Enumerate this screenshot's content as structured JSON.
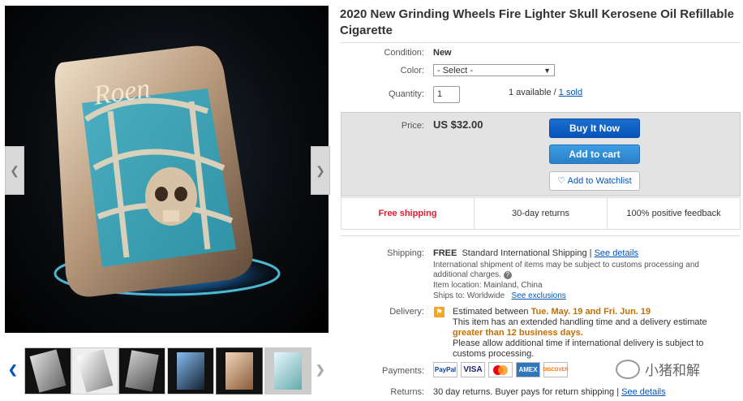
{
  "title": "2020 New Grinding Wheels Fire Lighter Skull Kerosene Oil Refillable Cigarette",
  "condition": {
    "label": "Condition:",
    "value": "New"
  },
  "color": {
    "label": "Color:",
    "selected": "- Select -"
  },
  "quantity": {
    "label": "Quantity:",
    "value": "1",
    "available": "1 available / ",
    "sold": "1 sold"
  },
  "price": {
    "label": "Price:",
    "value": "US $32.00"
  },
  "buttons": {
    "buy": "Buy It Now",
    "cart": "Add to cart",
    "watch": "Add to Watchlist"
  },
  "features": {
    "shipping": "Free shipping",
    "returns": "30-day returns",
    "feedback": "100% positive feedback"
  },
  "shipping": {
    "label": "Shipping:",
    "free": "FREE",
    "service": "Standard International Shipping |",
    "details": "See details",
    "note": "International shipment of items may be subject to customs processing and additional charges.",
    "location": "Item location:  Mainland, China",
    "ships_to": "Ships to: Worldwide",
    "exclusions": "See exclusions"
  },
  "delivery": {
    "label": "Delivery:",
    "estimated": "Estimated between ",
    "dates": "Tue. May. 19 and Fri. Jun. 19",
    "line2": "This item has an extended handling time and a delivery estimate ",
    "greater": "greater than 12 business days.",
    "line3": "Please allow additional time if international delivery is subject to customs processing."
  },
  "payments": {
    "label": "Payments:",
    "logos": [
      "PayPal",
      "VISA",
      "MC",
      "AMEX",
      "DISCOVER"
    ]
  },
  "returns": {
    "label": "Returns:",
    "text": "30 day returns. Buyer pays for return shipping |",
    "details": "See details"
  },
  "lighter_text": "Roen",
  "watermark": "小猪和解",
  "colors": {
    "accent": "#0654ba",
    "shipping_red": "#dd1e31",
    "date_orange": "#c36e00"
  }
}
